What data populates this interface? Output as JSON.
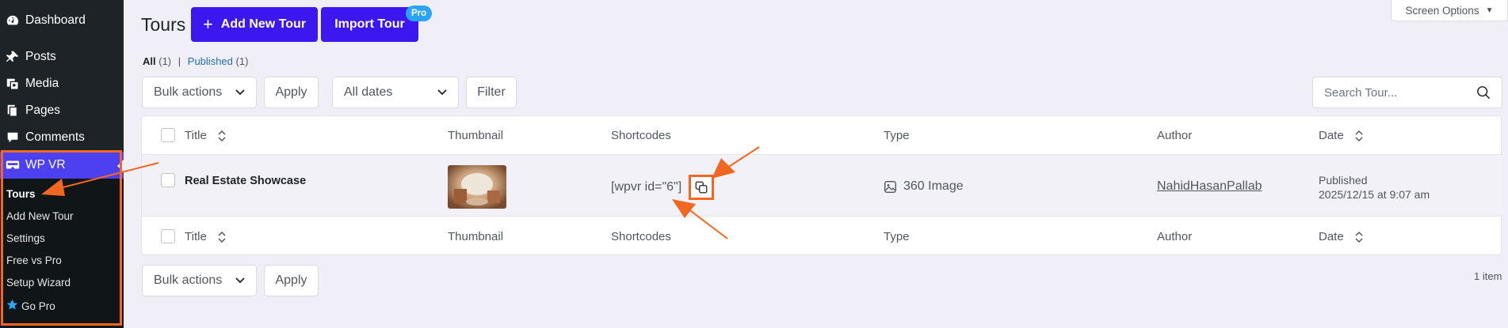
{
  "sidebar": {
    "items": [
      {
        "label": "Dashboard",
        "icon": "dashboard-icon"
      },
      {
        "label": "Posts",
        "icon": "pin-icon"
      },
      {
        "label": "Media",
        "icon": "media-icon"
      },
      {
        "label": "Pages",
        "icon": "pages-icon"
      },
      {
        "label": "Comments",
        "icon": "comments-icon"
      }
    ],
    "active": {
      "label": "WP VR",
      "icon": "vr-headset-icon"
    },
    "submenu": [
      "Tours",
      "Add New Tour",
      "Settings",
      "Free vs Pro",
      "Setup Wizard",
      "Go Pro"
    ]
  },
  "header": {
    "title": "Tours",
    "add_button": "Add New Tour",
    "import_button": "Import Tour",
    "pro_badge": "Pro",
    "screen_options": "Screen Options"
  },
  "filters": {
    "all_label": "All",
    "all_count": "(1)",
    "separator": "|",
    "published_label": "Published",
    "published_count": "(1)",
    "bulk_actions": "Bulk actions",
    "apply": "Apply",
    "all_dates": "All dates",
    "filter": "Filter",
    "search_placeholder": "Search Tour..."
  },
  "table": {
    "columns": [
      "Title",
      "Thumbnail",
      "Shortcodes",
      "Type",
      "Author",
      "Date"
    ],
    "rows": [
      {
        "title": "Real Estate Showcase",
        "shortcode": "[wpvr id=\"6\"]",
        "type": "360 Image",
        "author": "NahidHasanPallab",
        "date_status": "Published",
        "date": "2025/12/15 at 9:07 am"
      }
    ]
  },
  "footer": {
    "bulk_actions": "Bulk actions",
    "apply": "Apply",
    "items_count": "1 item"
  },
  "colors": {
    "primary": "#3d17f0",
    "annotation": "#f26722",
    "sidebar": "#1d2327",
    "pro_badge": "#2aa4f4"
  }
}
